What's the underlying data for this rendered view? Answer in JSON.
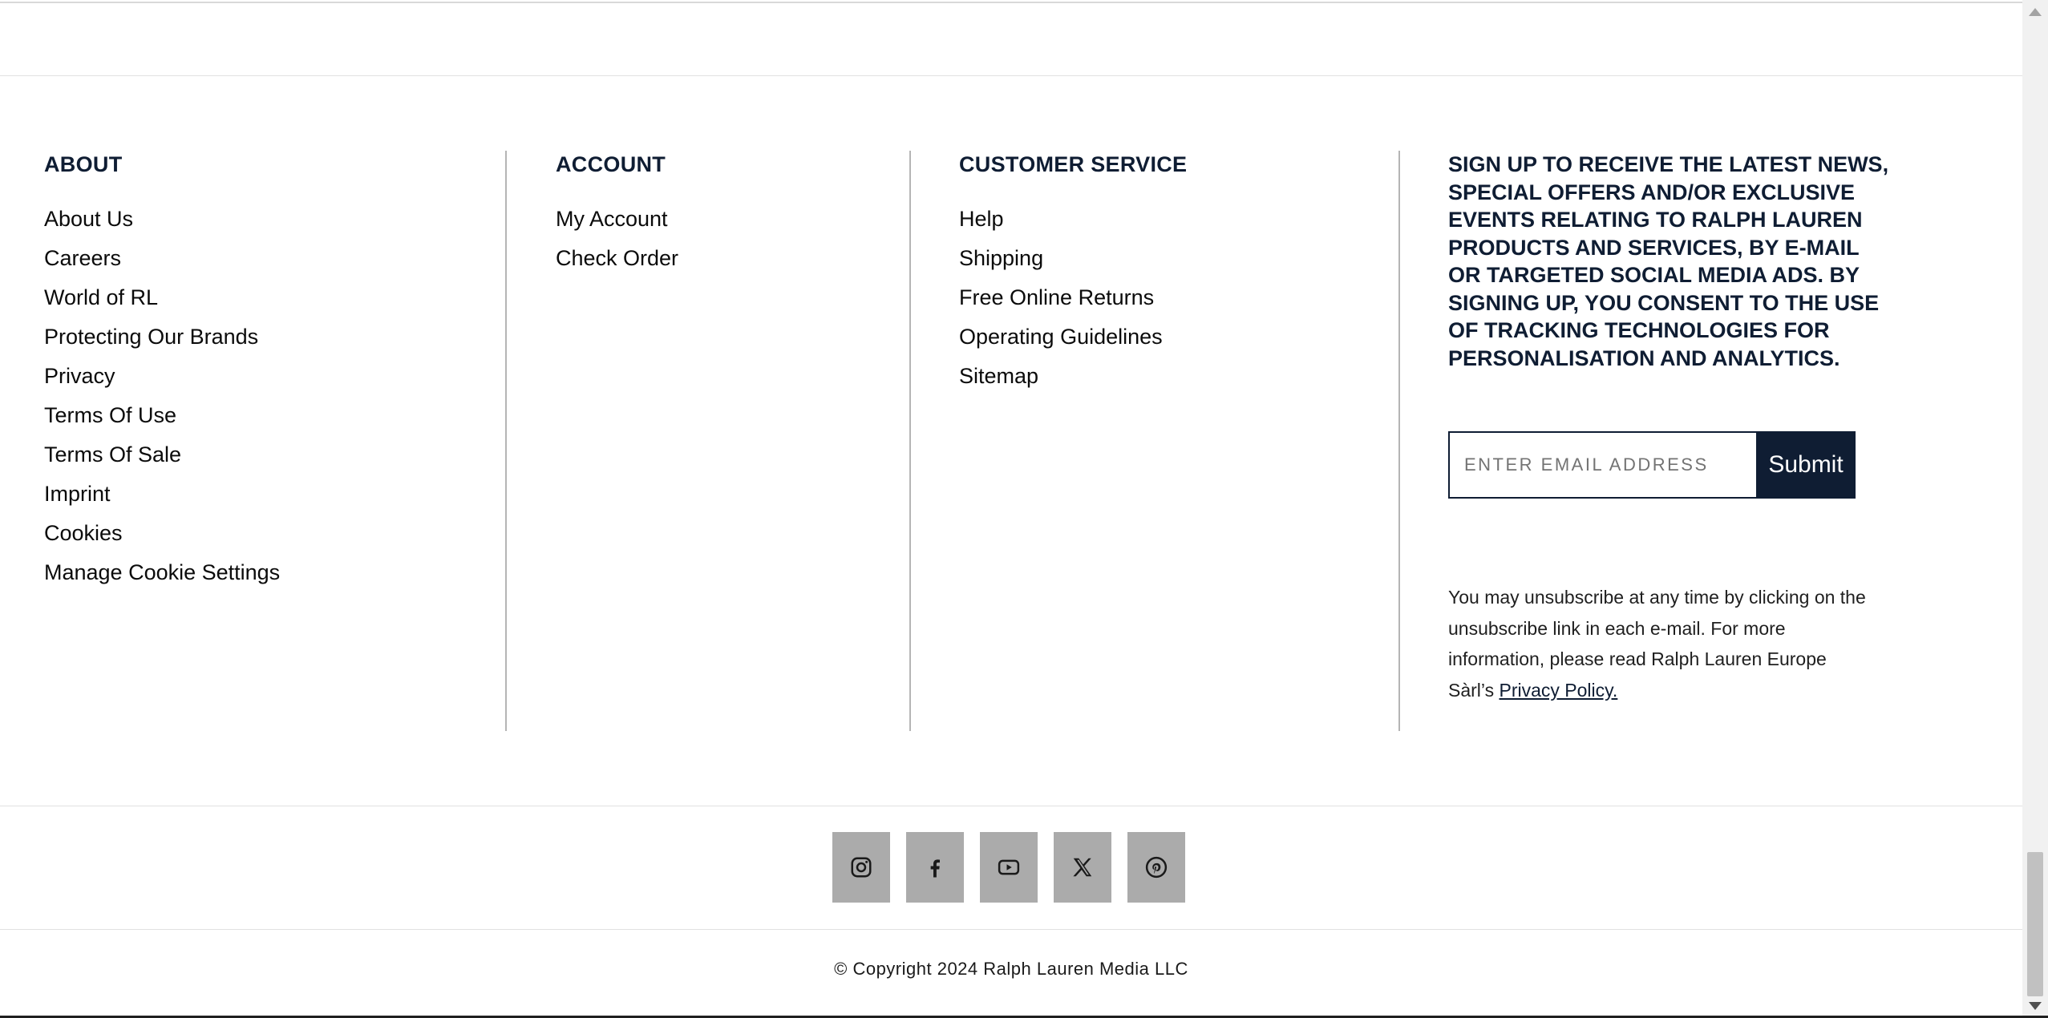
{
  "about": {
    "heading": "ABOUT",
    "links": [
      "About Us",
      "Careers",
      "World of RL",
      "Protecting Our Brands",
      "Privacy",
      "Terms Of Use",
      "Terms Of Sale",
      "Imprint",
      "Cookies",
      "Manage Cookie Settings"
    ]
  },
  "account": {
    "heading": "ACCOUNT",
    "links": [
      "My Account",
      "Check Order"
    ]
  },
  "customer_service": {
    "heading": "CUSTOMER SERVICE",
    "links": [
      "Help",
      "Shipping",
      "Free Online Returns",
      "Operating Guidelines",
      "Sitemap"
    ]
  },
  "newsletter": {
    "heading": "SIGN UP TO RECEIVE THE LATEST NEWS, SPECIAL OFFERS AND/OR EXCLUSIVE EVENTS RELATING TO RALPH LAUREN PRODUCTS AND SERVICES, BY E-MAIL OR TARGETED SOCIAL MEDIA ADS. BY SIGNING UP, YOU CONSENT TO THE USE OF TRACKING TECHNOLOGIES FOR PERSONALISATION AND ANALYTICS.",
    "email_placeholder": "ENTER EMAIL ADDRESS",
    "submit_label": "Submit",
    "unsubscribe_text": "You may unsubscribe at any time by clicking on the unsubscribe link in each e-mail. For more information, please read Ralph Lauren Europe Sàrl’s",
    "privacy_link": "Privacy Policy."
  },
  "social": {
    "icons": [
      "instagram-icon",
      "facebook-icon",
      "youtube-icon",
      "x-icon",
      "pinterest-icon"
    ]
  },
  "copyright": "© Copyright 2024 Ralph Lauren Media LLC",
  "colors": {
    "navy": "#0f1d33",
    "social_bg": "#ababab",
    "divider": "#b5b5b5"
  }
}
